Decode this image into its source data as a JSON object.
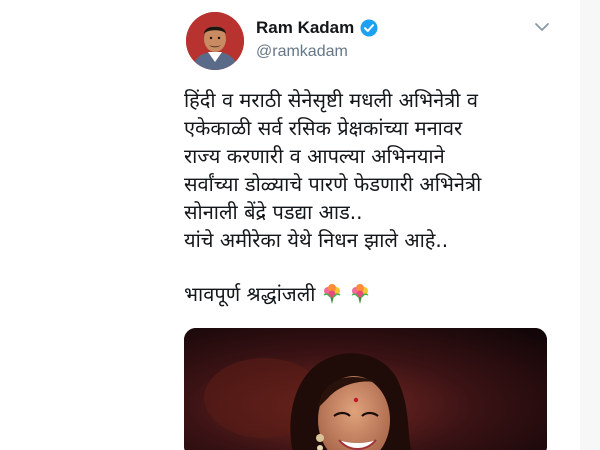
{
  "tweet": {
    "author": {
      "name": "Ram Kadam",
      "handle": "@ramkadam",
      "verified": true,
      "avatar_icon": "profile-photo"
    },
    "menu_icon": "chevron-down-icon",
    "text_lines": [
      "हिंदी व मराठी सेनेसृष्टी मधली अभिनेत्री व",
      "एकेकाळी सर्व रसिक प्रेक्षकांच्या मनावर",
      "राज्य करणारी व आपल्या अभिनयाने",
      "सर्वांच्या डोळ्याचे पारणे फेडणारी अभिनेत्री",
      "सोनाली बेंद्रे पडद्या आड..",
      "यांचे अमीरेका येथे निधन झाले आहे.."
    ],
    "tribute": "भावपूर्ण श्रद्धांजली",
    "tribute_icons": [
      "bouquet-icon",
      "bouquet-icon"
    ],
    "media_image": "photo-of-actress-smiling"
  },
  "colors": {
    "text": "#14171a",
    "secondary": "#657786",
    "verified_blue": "#1da1f2",
    "media_bg": "#1a0a0c"
  }
}
